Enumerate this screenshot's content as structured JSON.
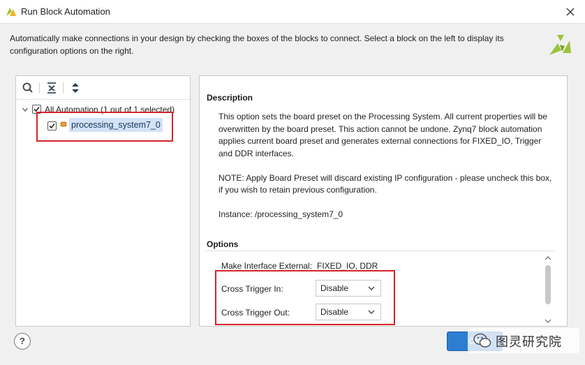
{
  "window": {
    "title": "Run Block Automation"
  },
  "intro": "Automatically make connections in your design by checking the boxes of the blocks to connect. Select a block on the left to display its configuration options on the right.",
  "tree": {
    "root_label": "All Automation (1 out of 1 selected)",
    "root_checked": true,
    "child_label": "processing_system7_0",
    "child_checked": true
  },
  "description": {
    "title": "Description",
    "para1": "This option sets the board preset on the Processing System. All current properties will be overwritten by the board preset. This action cannot be undone. Zynq7 block automation applies current board preset and generates external connections for FIXED_IO, Trigger and DDR interfaces.",
    "para2": "NOTE: Apply Board Preset will discard existing IP configuration - please uncheck this box, if you wish to retain previous configuration.",
    "para3": "Instance: /processing_system7_0"
  },
  "options": {
    "title": "Options",
    "make_interface_label": "Make Interface External:",
    "make_interface_value": "FIXED_IO, DDR",
    "cross_trigger_in_label": "Cross Trigger In:",
    "cross_trigger_in_value": "Disable",
    "cross_trigger_out_label": "Cross Trigger Out:",
    "cross_trigger_out_value": "Disable"
  },
  "buttons": {
    "help": "?",
    "ok": "OK"
  },
  "watermark": "图灵研究院",
  "colors": {
    "highlight_red": "#d6242a",
    "selection_blue": "#d3e2f5",
    "ok_blue": "#2d7dd2",
    "brand_green": "#9bc43a"
  },
  "icons": [
    "app-logo-icon",
    "close-icon",
    "search-icon",
    "collapse-all-icon",
    "expand-all-icon",
    "chip-icon",
    "help-icon",
    "wechat-icon",
    "chevron-down-icon"
  ]
}
